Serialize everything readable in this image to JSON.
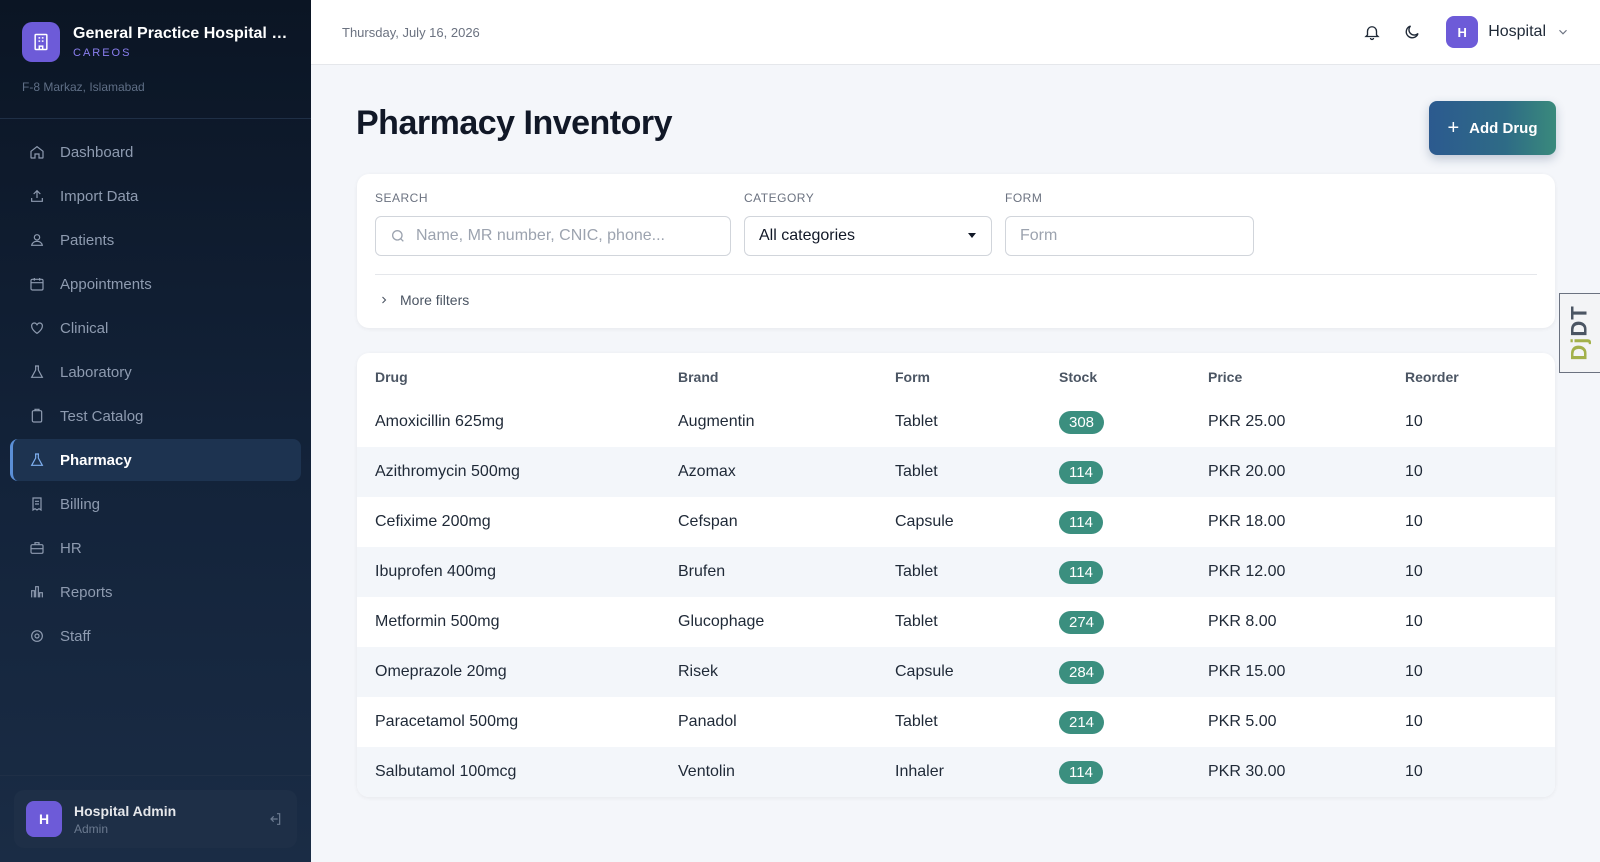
{
  "sidebar": {
    "hospital_name": "General Practice Hospital I...",
    "brand_sub": "CAREOS",
    "address": "F-8 Markaz, Islamabad",
    "items": [
      {
        "label": "Dashboard",
        "icon": "home-icon"
      },
      {
        "label": "Import Data",
        "icon": "upload-icon"
      },
      {
        "label": "Patients",
        "icon": "users-icon"
      },
      {
        "label": "Appointments",
        "icon": "calendar-icon"
      },
      {
        "label": "Clinical",
        "icon": "heart-icon"
      },
      {
        "label": "Laboratory",
        "icon": "flask-icon"
      },
      {
        "label": "Test Catalog",
        "icon": "clipboard-icon"
      },
      {
        "label": "Pharmacy",
        "icon": "flask-icon",
        "active": true
      },
      {
        "label": "Billing",
        "icon": "receipt-icon"
      },
      {
        "label": "HR",
        "icon": "briefcase-icon"
      },
      {
        "label": "Reports",
        "icon": "bar-chart-icon"
      },
      {
        "label": "Staff",
        "icon": "gear-icon"
      }
    ],
    "user": {
      "initial": "H",
      "name": "Hospital Admin",
      "role": "Admin"
    }
  },
  "topbar": {
    "date": "Thursday, July 16, 2026",
    "account_initial": "H",
    "account_name": "Hospital"
  },
  "page": {
    "title": "Pharmacy Inventory",
    "add_button": "Add Drug"
  },
  "filters": {
    "search_label": "SEARCH",
    "search_placeholder": "Name, MR number, CNIC, phone...",
    "category_label": "CATEGORY",
    "category_value": "All categories",
    "form_label": "FORM",
    "form_placeholder": "Form",
    "more_filters": "More filters"
  },
  "table": {
    "columns": [
      "Drug",
      "Brand",
      "Form",
      "Stock",
      "Price",
      "Reorder"
    ],
    "rows": [
      {
        "drug": "Amoxicillin 625mg",
        "brand": "Augmentin",
        "form": "Tablet",
        "stock": "308",
        "price": "PKR 25.00",
        "reorder": "10"
      },
      {
        "drug": "Azithromycin 500mg",
        "brand": "Azomax",
        "form": "Tablet",
        "stock": "114",
        "price": "PKR 20.00",
        "reorder": "10"
      },
      {
        "drug": "Cefixime 200mg",
        "brand": "Cefspan",
        "form": "Capsule",
        "stock": "114",
        "price": "PKR 18.00",
        "reorder": "10"
      },
      {
        "drug": "Ibuprofen 400mg",
        "brand": "Brufen",
        "form": "Tablet",
        "stock": "114",
        "price": "PKR 12.00",
        "reorder": "10"
      },
      {
        "drug": "Metformin 500mg",
        "brand": "Glucophage",
        "form": "Tablet",
        "stock": "274",
        "price": "PKR 8.00",
        "reorder": "10"
      },
      {
        "drug": "Omeprazole 20mg",
        "brand": "Risek",
        "form": "Capsule",
        "stock": "284",
        "price": "PKR 15.00",
        "reorder": "10"
      },
      {
        "drug": "Paracetamol 500mg",
        "brand": "Panadol",
        "form": "Tablet",
        "stock": "214",
        "price": "PKR 5.00",
        "reorder": "10"
      },
      {
        "drug": "Salbutamol 100mcg",
        "brand": "Ventolin",
        "form": "Inhaler",
        "stock": "114",
        "price": "PKR 30.00",
        "reorder": "10"
      }
    ]
  },
  "debug_tab": {
    "prefix": "Dj",
    "suffix": "DT"
  },
  "colors": {
    "accent": "#6d5bd8",
    "stock_pill": "#3b8f7f",
    "sidebar_bg": "#0b1524"
  }
}
